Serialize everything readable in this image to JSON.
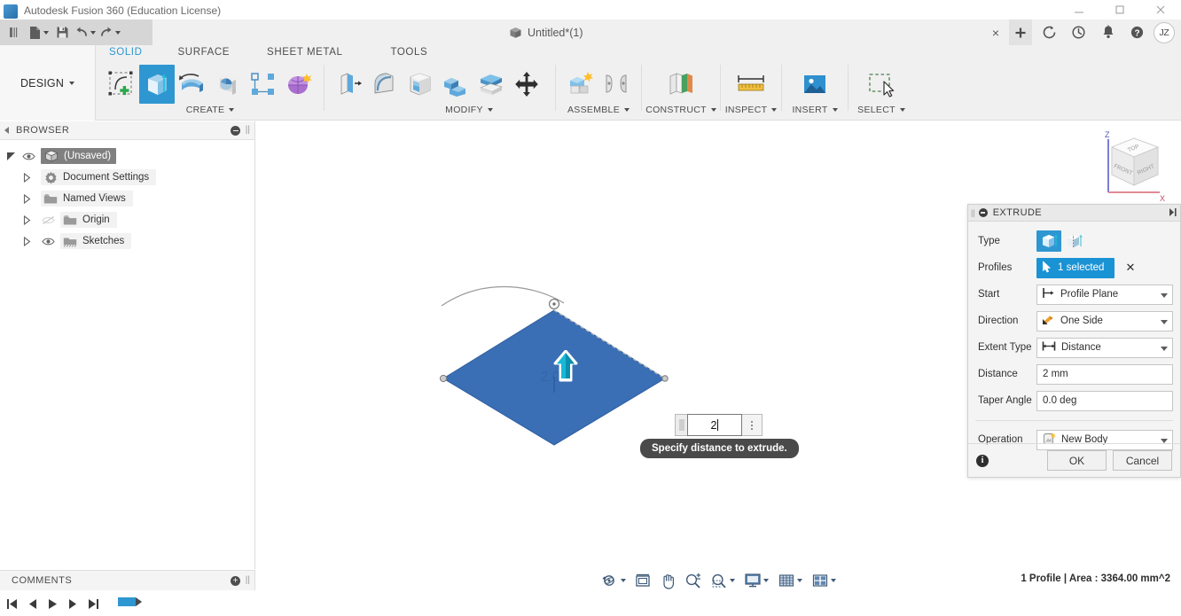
{
  "window": {
    "app_title": "Autodesk Fusion 360 (Education License)",
    "app_icon": "fusion-logo-icon",
    "minimize": "minimize-icon",
    "maximize": "maximize-icon",
    "close": "close-icon"
  },
  "quick_access": [
    {
      "name": "show-data-panel-icon",
      "label": "Show Data Panel"
    },
    {
      "name": "file-icon",
      "label": "File"
    },
    {
      "name": "save-icon",
      "label": "Save"
    },
    {
      "name": "undo-icon",
      "label": "Undo"
    },
    {
      "name": "redo-icon",
      "label": "Redo"
    }
  ],
  "document_tab": {
    "icon": "cube-icon",
    "title": "Untitled*(1)",
    "close_label": "×",
    "new_tab_label": "+"
  },
  "header_icons": [
    {
      "name": "job-status-icon",
      "label": "Job Status"
    },
    {
      "name": "recent-icon",
      "label": "Recent"
    },
    {
      "name": "notifications-bell-icon",
      "label": "Notifications"
    },
    {
      "name": "help-icon",
      "label": "Help"
    }
  ],
  "avatar": {
    "initials": "JZ"
  },
  "workspace": {
    "label": "DESIGN"
  },
  "ribbon": {
    "tabs": [
      {
        "label": "SOLID",
        "active": true
      },
      {
        "label": "SURFACE",
        "active": false
      },
      {
        "label": "SHEET METAL",
        "active": false
      },
      {
        "label": "TOOLS",
        "active": false
      }
    ],
    "panels": [
      {
        "name": "CREATE",
        "has_dropdown": true,
        "tools": [
          {
            "name": "create-sketch-icon",
            "label": "Create Sketch",
            "selected": false
          },
          {
            "name": "extrude-icon",
            "label": "Extrude",
            "selected": true
          },
          {
            "name": "revolve-icon",
            "label": "Revolve",
            "selected": false
          },
          {
            "name": "sweep-icon",
            "label": "Sweep",
            "selected": false
          },
          {
            "name": "pattern-icon",
            "label": "Pattern",
            "selected": false
          },
          {
            "name": "form-icon",
            "label": "Create Form",
            "selected": false
          }
        ]
      },
      {
        "name": "MODIFY",
        "has_dropdown": true,
        "tools": [
          {
            "name": "press-pull-icon",
            "label": "Press Pull",
            "selected": false
          },
          {
            "name": "fillet-icon",
            "label": "Fillet",
            "selected": false
          },
          {
            "name": "shell-icon",
            "label": "Shell",
            "selected": false
          },
          {
            "name": "combine-icon",
            "label": "Combine",
            "selected": false
          },
          {
            "name": "split-body-icon",
            "label": "Split Body",
            "selected": false
          },
          {
            "name": "move-copy-icon",
            "label": "Move/Copy",
            "selected": false
          }
        ]
      },
      {
        "name": "ASSEMBLE",
        "has_dropdown": true,
        "tools": [
          {
            "name": "new-component-icon",
            "label": "New Component",
            "selected": false
          },
          {
            "name": "joint-icon",
            "label": "Joint",
            "selected": false
          }
        ]
      },
      {
        "name": "CONSTRUCT",
        "has_dropdown": true,
        "tools": [
          {
            "name": "offset-plane-icon",
            "label": "Offset Plane",
            "selected": false
          }
        ]
      },
      {
        "name": "INSPECT",
        "has_dropdown": true,
        "tools": [
          {
            "name": "measure-icon",
            "label": "Measure",
            "selected": false
          }
        ]
      },
      {
        "name": "INSERT",
        "has_dropdown": true,
        "tools": [
          {
            "name": "insert-image-icon",
            "label": "Decal",
            "selected": false
          }
        ]
      },
      {
        "name": "SELECT",
        "has_dropdown": true,
        "tools": [
          {
            "name": "select-cursor-icon",
            "label": "Select",
            "selected": false
          }
        ]
      }
    ]
  },
  "browser": {
    "title": "BROWSER",
    "collapse_icon": "minus-circle-icon",
    "grip_icon": "grip-icon",
    "items": [
      {
        "label": "(Unsaved)",
        "icon": "component-cube-icon",
        "eye": "eye-visible-icon",
        "twist": "triangle-expanded-icon",
        "selected": true,
        "radio": "activate-radio-icon"
      },
      {
        "label": "Document Settings",
        "icon": "gear-icon",
        "eye": "",
        "twist": "triangle-collapsed-icon",
        "selected": false
      },
      {
        "label": "Named Views",
        "icon": "folder-icon",
        "eye": "",
        "twist": "triangle-collapsed-icon",
        "selected": false
      },
      {
        "label": "Origin",
        "icon": "folder-icon",
        "eye": "eye-hidden-icon",
        "twist": "triangle-collapsed-icon",
        "selected": false
      },
      {
        "label": "Sketches",
        "icon": "sketch-folder-icon",
        "eye": "eye-visible-icon",
        "twist": "triangle-collapsed-icon",
        "selected": false
      }
    ]
  },
  "comments": {
    "title": "COMMENTS",
    "add_icon": "plus-circle-icon",
    "grip_icon": "grip-icon"
  },
  "canvas": {
    "viewcube": {
      "name": "view-cube",
      "faces": {
        "top": "TOP",
        "front": "FRONT",
        "right": "RIGHT"
      },
      "axes": {
        "z": "Z",
        "x": "X"
      }
    },
    "manipulator": {
      "name": "extrude-arrow-handle",
      "direction": "up"
    },
    "distance_input": {
      "value": "2",
      "name": "distance-inline-input"
    },
    "tooltip": "Specify distance to extrude.",
    "body_color": "#3a6fb5"
  },
  "extrude_dialog": {
    "title": "EXTRUDE",
    "collapse_icon": "minus-circle-icon",
    "pin_icon": "pin-right-icon",
    "rows": [
      {
        "label": "Type",
        "kind": "iconset",
        "options": [
          "one-side-extrude-icon",
          "two-side-extrude-icon"
        ],
        "selected_index": 0
      },
      {
        "label": "Profiles",
        "kind": "selection",
        "value": "1 selected",
        "icon": "cursor-icon",
        "clear": "✕"
      },
      {
        "label": "Start",
        "kind": "combo",
        "value": "Profile Plane",
        "icon": "profile-plane-icon"
      },
      {
        "label": "Direction",
        "kind": "combo",
        "value": "One Side",
        "icon": "one-side-direction-icon"
      },
      {
        "label": "Extent Type",
        "kind": "combo",
        "value": "Distance",
        "icon": "distance-extent-icon"
      },
      {
        "label": "Distance",
        "kind": "text",
        "value": "2 mm"
      },
      {
        "label": "Taper Angle",
        "kind": "text",
        "value": "0.0 deg"
      },
      {
        "label": "Operation",
        "kind": "combo",
        "value": "New Body",
        "icon": "new-body-icon"
      }
    ],
    "info_icon": "info-icon",
    "ok_label": "OK",
    "cancel_label": "Cancel"
  },
  "navbar": {
    "buttons": [
      {
        "name": "orbit-icon",
        "label": "Orbit",
        "has_dropdown": true
      },
      {
        "name": "look-at-icon",
        "label": "Look At",
        "has_dropdown": false
      },
      {
        "name": "pan-icon",
        "label": "Pan",
        "has_dropdown": false
      },
      {
        "name": "zoom-icon",
        "label": "Zoom",
        "has_dropdown": false
      },
      {
        "name": "fit-icon",
        "label": "Fit",
        "has_dropdown": true
      },
      {
        "name": "display-settings-icon",
        "label": "Display Settings",
        "has_dropdown": true
      },
      {
        "name": "grid-snaps-icon",
        "label": "Grid and Snaps",
        "has_dropdown": true
      },
      {
        "name": "viewports-icon",
        "label": "Viewports",
        "has_dropdown": true
      }
    ]
  },
  "status_bar": {
    "text": "1 Profile | Area : 3364.00 mm^2"
  },
  "timeline": {
    "controls": [
      {
        "name": "jump-to-beginning-icon",
        "label": "Jump to Beginning"
      },
      {
        "name": "step-back-icon",
        "label": "Step Back"
      },
      {
        "name": "play-icon",
        "label": "Play"
      },
      {
        "name": "step-forward-icon",
        "label": "Step Forward"
      },
      {
        "name": "jump-to-end-icon",
        "label": "Jump to End"
      }
    ],
    "features": [
      {
        "name": "sketch-feature-icon",
        "label": "Sketch1"
      }
    ]
  }
}
